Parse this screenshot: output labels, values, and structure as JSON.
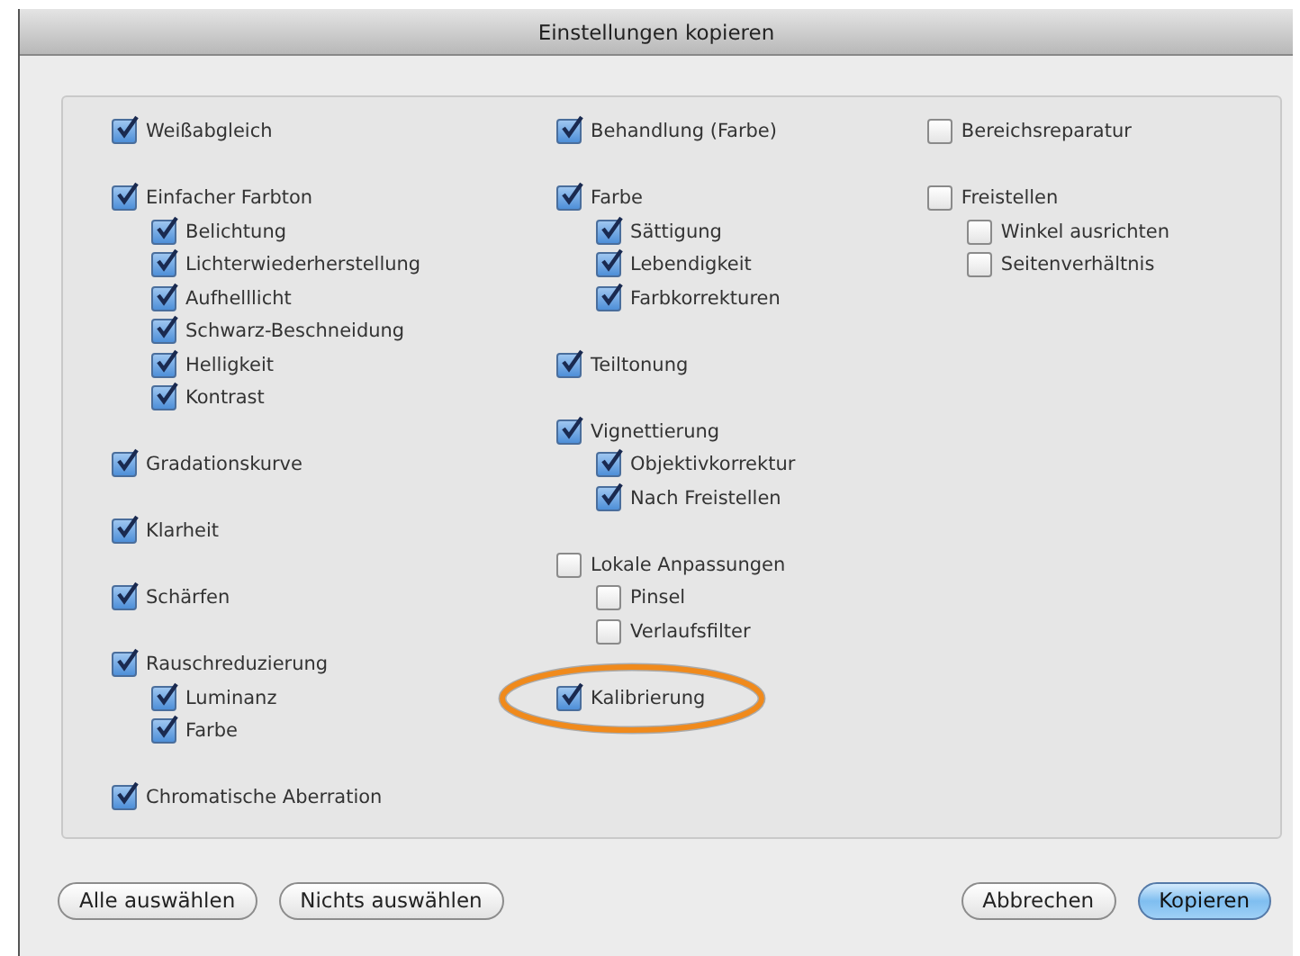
{
  "window": {
    "title": "Einstellungen kopieren"
  },
  "columns": [
    {
      "groups": [
        {
          "label": "Weißabgleich",
          "checked": true
        },
        {
          "label": "Einfacher Farbton",
          "checked": true,
          "children": [
            {
              "label": "Belichtung",
              "checked": true
            },
            {
              "label": "Lichterwiederherstellung",
              "checked": true
            },
            {
              "label": "Aufhelllicht",
              "checked": true
            },
            {
              "label": "Schwarz-Beschneidung",
              "checked": true
            },
            {
              "label": "Helligkeit",
              "checked": true
            },
            {
              "label": "Kontrast",
              "checked": true
            }
          ]
        },
        {
          "label": "Gradationskurve",
          "checked": true
        },
        {
          "label": "Klarheit",
          "checked": true
        },
        {
          "label": "Schärfen",
          "checked": true
        },
        {
          "label": "Rauschreduzierung",
          "checked": true,
          "children": [
            {
              "label": "Luminanz",
              "checked": true
            },
            {
              "label": "Farbe",
              "checked": true
            }
          ]
        },
        {
          "label": "Chromatische Aberration",
          "checked": true
        }
      ]
    },
    {
      "groups": [
        {
          "label": "Behandlung (Farbe)",
          "checked": true
        },
        {
          "label": "Farbe",
          "checked": true,
          "children": [
            {
              "label": "Sättigung",
              "checked": true
            },
            {
              "label": "Lebendigkeit",
              "checked": true
            },
            {
              "label": "Farbkorrekturen",
              "checked": true
            }
          ]
        },
        {
          "label": "Teiltonung",
          "checked": true
        },
        {
          "label": "Vignettierung",
          "checked": true,
          "children": [
            {
              "label": "Objektivkorrektur",
              "checked": true
            },
            {
              "label": "Nach Freistellen",
              "checked": true
            }
          ]
        },
        {
          "label": "Lokale Anpassungen",
          "checked": false,
          "children": [
            {
              "label": "Pinsel",
              "checked": false
            },
            {
              "label": "Verlaufsfilter",
              "checked": false
            }
          ]
        },
        {
          "label": "Kalibrierung",
          "checked": true,
          "highlighted": true
        }
      ]
    },
    {
      "groups": [
        {
          "label": "Bereichsreparatur",
          "checked": false
        },
        {
          "label": "Freistellen",
          "checked": false,
          "children": [
            {
              "label": "Winkel ausrichten",
              "checked": false
            },
            {
              "label": "Seitenverhältnis",
              "checked": false
            }
          ]
        }
      ]
    }
  ],
  "left_buttons": [
    {
      "label": "Alle auswählen",
      "default": false
    },
    {
      "label": "Nichts auswählen",
      "default": false
    }
  ],
  "right_buttons": [
    {
      "label": "Abbrechen",
      "default": false
    },
    {
      "label": "Kopieren",
      "default": true
    }
  ]
}
